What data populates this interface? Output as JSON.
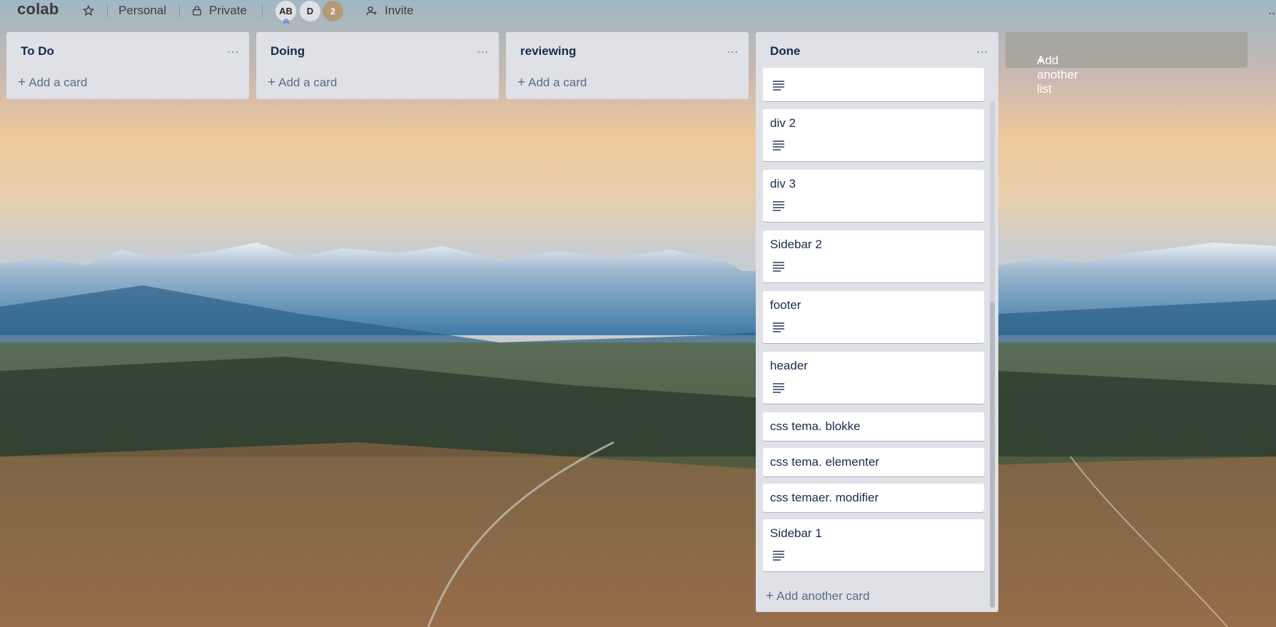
{
  "header": {
    "board_title": "colab",
    "personal_label": "Personal",
    "private_label": "Private",
    "members": [
      "AB",
      "D"
    ],
    "extra_members": "2",
    "invite_label": "Invite",
    "more": "..."
  },
  "lists": [
    {
      "title": "To Do",
      "menu": "...",
      "add_card": "Add a card"
    },
    {
      "title": "Doing",
      "menu": "...",
      "add_card": "Add a card"
    },
    {
      "title": "reviewing",
      "menu": "...",
      "add_card": "Add a card"
    },
    {
      "title": "Done",
      "menu": "...",
      "add_card": "Add another card",
      "cards": [
        {
          "title": "",
          "has_description": true
        },
        {
          "title": "div 2",
          "has_description": true
        },
        {
          "title": "div 3",
          "has_description": true
        },
        {
          "title": "Sidebar 2",
          "has_description": true
        },
        {
          "title": "footer",
          "has_description": true
        },
        {
          "title": "header",
          "has_description": true
        },
        {
          "title": "css tema. blokke",
          "has_description": false
        },
        {
          "title": "css tema. elementer",
          "has_description": false
        },
        {
          "title": "css temaer. modifier",
          "has_description": false
        },
        {
          "title": "Sidebar 1",
          "has_description": true
        }
      ]
    }
  ],
  "add_list_label": "Add another list",
  "icons": {
    "star": "star-icon",
    "lock": "lock-icon",
    "invite": "add-person-icon",
    "description": "description-icon"
  },
  "colors": {
    "list_bg": "#dfe1e6",
    "card_bg": "#ffffff",
    "text": "#172b4d",
    "muted": "#5e6c84"
  }
}
